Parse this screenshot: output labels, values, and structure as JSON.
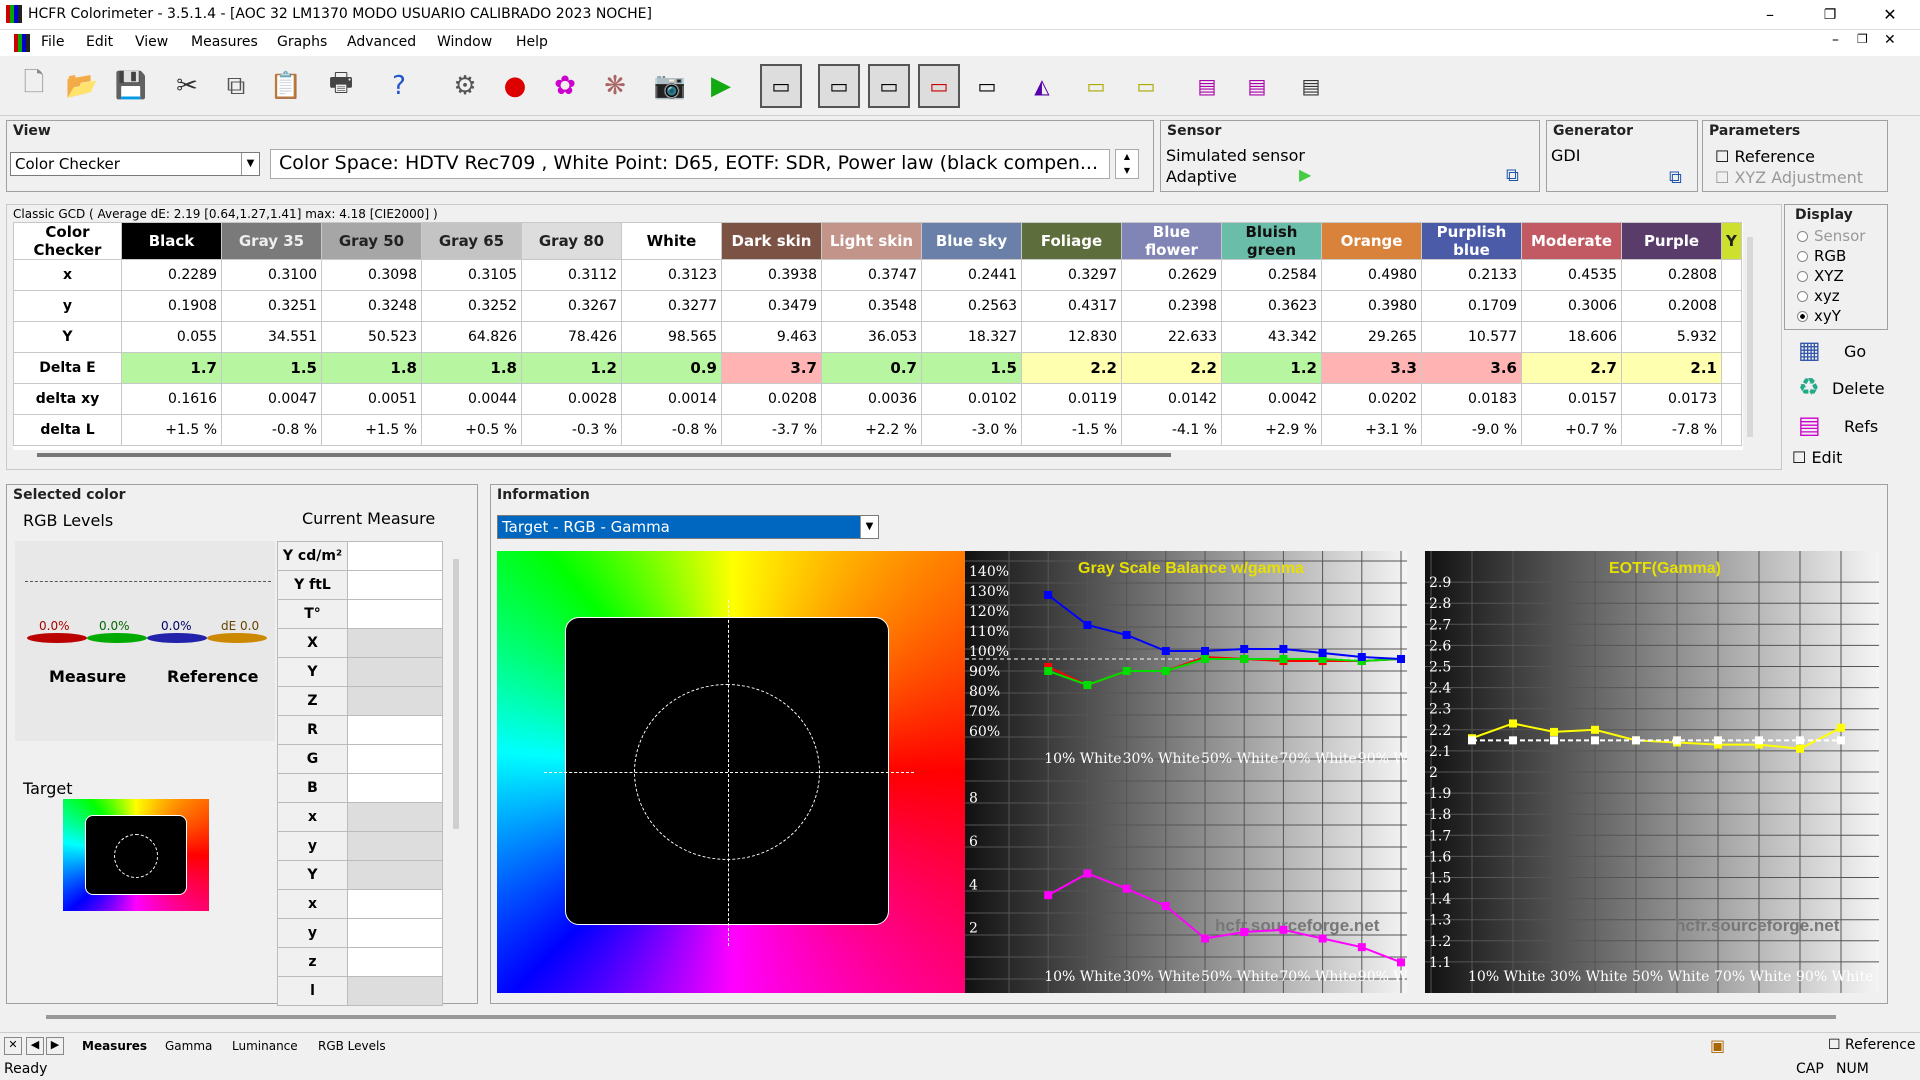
{
  "window": {
    "title": "HCFR Colorimeter - 3.5.1.4 - [AOC 32 LM1370 MODO USUARIO CALIBRADO 2023 NOCHE]",
    "minimize": "–",
    "maximize": "❐",
    "close": "✕",
    "mdi_min": "–",
    "mdi_restore": "❐",
    "mdi_close": "✕"
  },
  "menu": [
    "File",
    "Edit",
    "View",
    "Measures",
    "Graphs",
    "Advanced",
    "Window",
    "Help"
  ],
  "view": {
    "title": "View",
    "selector": "Color Checker",
    "info": "Color Space: HDTV Rec709 , White Point: D65, EOTF:  SDR, Power law (black compen..."
  },
  "sensor": {
    "title": "Sensor",
    "name": "Simulated sensor",
    "mode": "Adaptive"
  },
  "generator": {
    "title": "Generator",
    "name": "GDI"
  },
  "parameters": {
    "title": "Parameters",
    "reference": "Reference",
    "xyz_adjustment": "XYZ Adjustment"
  },
  "grid": {
    "caption": "Classic GCD ( Average dE: 2.19 [0.64,1.27,1.41] max: 4.18 [CIE2000] )",
    "corner": "Color Checker",
    "columns": [
      {
        "name": "Black",
        "bg": "#000000",
        "fg": "#ffffff"
      },
      {
        "name": "Gray 35",
        "bg": "#7a7a7a",
        "fg": "#eeeeee"
      },
      {
        "name": "Gray 50",
        "bg": "#a6a6a6",
        "fg": "#222222"
      },
      {
        "name": "Gray 65",
        "bg": "#c4c4c4",
        "fg": "#222222"
      },
      {
        "name": "Gray 80",
        "bg": "#dddddd",
        "fg": "#222222"
      },
      {
        "name": "White",
        "bg": "#ffffff",
        "fg": "#000000"
      },
      {
        "name": "Dark skin",
        "bg": "#7b5244",
        "fg": "#ffffff"
      },
      {
        "name": "Light skin",
        "bg": "#c3958a",
        "fg": "#ffffff"
      },
      {
        "name": "Blue sky",
        "bg": "#6a80a8",
        "fg": "#ffffff"
      },
      {
        "name": "Foliage",
        "bg": "#5d6e3c",
        "fg": "#ffffff"
      },
      {
        "name": "Blue flower",
        "bg": "#8185b6",
        "fg": "#ffffff"
      },
      {
        "name": "Bluish green",
        "bg": "#6abda8",
        "fg": "#111111"
      },
      {
        "name": "Orange",
        "bg": "#d9823c",
        "fg": "#ffffff"
      },
      {
        "name": "Purplish blue",
        "bg": "#4c5ba8",
        "fg": "#ffffff"
      },
      {
        "name": "Moderate",
        "bg": "#c25a63",
        "fg": "#ffffff"
      },
      {
        "name": "Purple",
        "bg": "#5a3c6b",
        "fg": "#ffffff"
      }
    ],
    "rows": [
      {
        "label": "x",
        "values": [
          "0.2289",
          "0.3100",
          "0.3098",
          "0.3105",
          "0.3112",
          "0.3123",
          "0.3938",
          "0.3747",
          "0.2441",
          "0.3297",
          "0.2629",
          "0.2584",
          "0.4980",
          "0.2133",
          "0.4535",
          "0.2808"
        ]
      },
      {
        "label": "y",
        "values": [
          "0.1908",
          "0.3251",
          "0.3248",
          "0.3252",
          "0.3267",
          "0.3277",
          "0.3479",
          "0.3548",
          "0.2563",
          "0.4317",
          "0.2398",
          "0.3623",
          "0.3980",
          "0.1709",
          "0.3006",
          "0.2008"
        ]
      },
      {
        "label": "Y",
        "values": [
          "0.055",
          "34.551",
          "50.523",
          "64.826",
          "78.426",
          "98.565",
          "9.463",
          "36.053",
          "18.327",
          "12.830",
          "22.633",
          "43.342",
          "29.265",
          "10.577",
          "18.606",
          "5.932"
        ]
      },
      {
        "label": "Delta E",
        "values": [
          "1.7",
          "1.5",
          "1.8",
          "1.8",
          "1.2",
          "0.9",
          "3.7",
          "0.7",
          "1.5",
          "2.2",
          "2.2",
          "1.2",
          "3.3",
          "3.6",
          "2.7",
          "2.1"
        ]
      },
      {
        "label": "delta xy",
        "values": [
          "0.1616",
          "0.0047",
          "0.0051",
          "0.0044",
          "0.0028",
          "0.0014",
          "0.0208",
          "0.0036",
          "0.0102",
          "0.0119",
          "0.0142",
          "0.0042",
          "0.0202",
          "0.0183",
          "0.0157",
          "0.0173"
        ]
      },
      {
        "label": "delta L",
        "values": [
          "+1.5 %",
          "-0.8 %",
          "+1.5 %",
          "+0.5 %",
          "-0.3 %",
          "-0.8 %",
          "-3.7 %",
          "+2.2 %",
          "-3.0 %",
          "-1.5 %",
          "-4.1 %",
          "+2.9 %",
          "+3.1 %",
          "-9.0 %",
          "+0.7 %",
          "-7.8 %"
        ]
      }
    ],
    "delta_e_colors": [
      "#b8f5a0",
      "#b8f5a0",
      "#b8f5a0",
      "#b8f5a0",
      "#b8f5a0",
      "#b8f5a0",
      "#ffb3b3",
      "#b8f5a0",
      "#b8f5a0",
      "#ffffb0",
      "#ffffb0",
      "#b8f5a0",
      "#ffb3b3",
      "#ffb3b3",
      "#ffffb0",
      "#ffffb0"
    ],
    "partial_col": "Y"
  },
  "display": {
    "title": "Display",
    "options": [
      "Sensor",
      "RGB",
      "XYZ",
      "xyz",
      "xyY"
    ],
    "selected": 4,
    "go": "Go",
    "delete": "Delete",
    "refs": "Refs",
    "edit": "Edit"
  },
  "selected_color": {
    "title": "Selected color",
    "rgb_levels": "RGB Levels",
    "current_measure": "Current Measure",
    "bar_labels": [
      "0.0%",
      "0.0%",
      "0.0%",
      "dE 0.0"
    ],
    "measure": "Measure",
    "reference": "Reference",
    "target": "Target",
    "measure_rows": [
      "Y cd/m²",
      "Y ftL",
      "T°",
      "X",
      "Y",
      "Z",
      "R",
      "G",
      "B",
      "x",
      "y",
      "Y",
      "x",
      "y",
      "z",
      "l"
    ]
  },
  "information": {
    "title": "Information",
    "selector": "Target - RGB - Gamma"
  },
  "gray_chart": {
    "title": "Gray Scale Balance w/gamma",
    "yticks": [
      "140%",
      "130%",
      "120%",
      "110%",
      "100%",
      "90%",
      "80%",
      "70%",
      "60%"
    ],
    "xticks": [
      "10% White",
      "30% White",
      "50% White",
      "70% White",
      "90% White"
    ],
    "lower_ticks": [
      "8",
      "6",
      "4",
      "2"
    ],
    "watermark": "hcfr.sourceforge.net",
    "chart_data": {
      "type": "line",
      "x": [
        0,
        10,
        20,
        30,
        40,
        50,
        60,
        70,
        80,
        90,
        100
      ],
      "series": [
        {
          "name": "Red",
          "color": "#ff0000",
          "values": [
            null,
            92,
            83,
            90,
            90,
            97,
            96,
            95,
            95,
            95,
            96
          ]
        },
        {
          "name": "Green",
          "color": "#00dd00",
          "values": [
            null,
            90,
            83,
            90,
            90,
            96,
            96,
            96,
            96,
            95,
            96
          ]
        },
        {
          "name": "Blue",
          "color": "#0000ff",
          "values": [
            null,
            128,
            113,
            108,
            100,
            100,
            101,
            101,
            99,
            97,
            96
          ]
        },
        {
          "name": "dE",
          "color": "#ff00ff",
          "values": [
            null,
            3.5,
            4.5,
            3.8,
            3.0,
            1.5,
            1.8,
            1.9,
            1.5,
            1.1,
            0.4
          ]
        }
      ],
      "ylim": [
        55,
        145
      ]
    }
  },
  "eotf_chart": {
    "title": "EOTF(Gamma)",
    "yticks": [
      "2.9",
      "2.8",
      "2.7",
      "2.6",
      "2.5",
      "2.4",
      "2.3",
      "2.2",
      "2.1",
      "2",
      "1.9",
      "1.8",
      "1.7",
      "1.6",
      "1.5",
      "1.4",
      "1.3",
      "1.2",
      "1.1"
    ],
    "xticks": [
      "10% White",
      "30% White",
      "50% White",
      "70% White",
      "90% White"
    ],
    "watermark": "hcfr.sourceforge.net",
    "chart_data": {
      "type": "line",
      "x": [
        10,
        20,
        30,
        40,
        50,
        60,
        70,
        80,
        90,
        100
      ],
      "series": [
        {
          "name": "Measured",
          "color": "#ffff00",
          "values": [
            2.16,
            2.23,
            2.19,
            2.2,
            2.15,
            2.14,
            2.13,
            2.13,
            2.11,
            2.21
          ]
        },
        {
          "name": "Target",
          "color": "#ffffff",
          "values": [
            2.15,
            2.15,
            2.15,
            2.15,
            2.15,
            2.15,
            2.15,
            2.15,
            2.15,
            2.15
          ]
        }
      ],
      "ylim": [
        1.0,
        3.0
      ]
    }
  },
  "tabs": [
    "Measures",
    "Gamma",
    "Luminance",
    "RGB Levels"
  ],
  "statusbar": {
    "ready": "Ready",
    "reference": "Reference",
    "cap": "CAP",
    "num": "NUM"
  }
}
